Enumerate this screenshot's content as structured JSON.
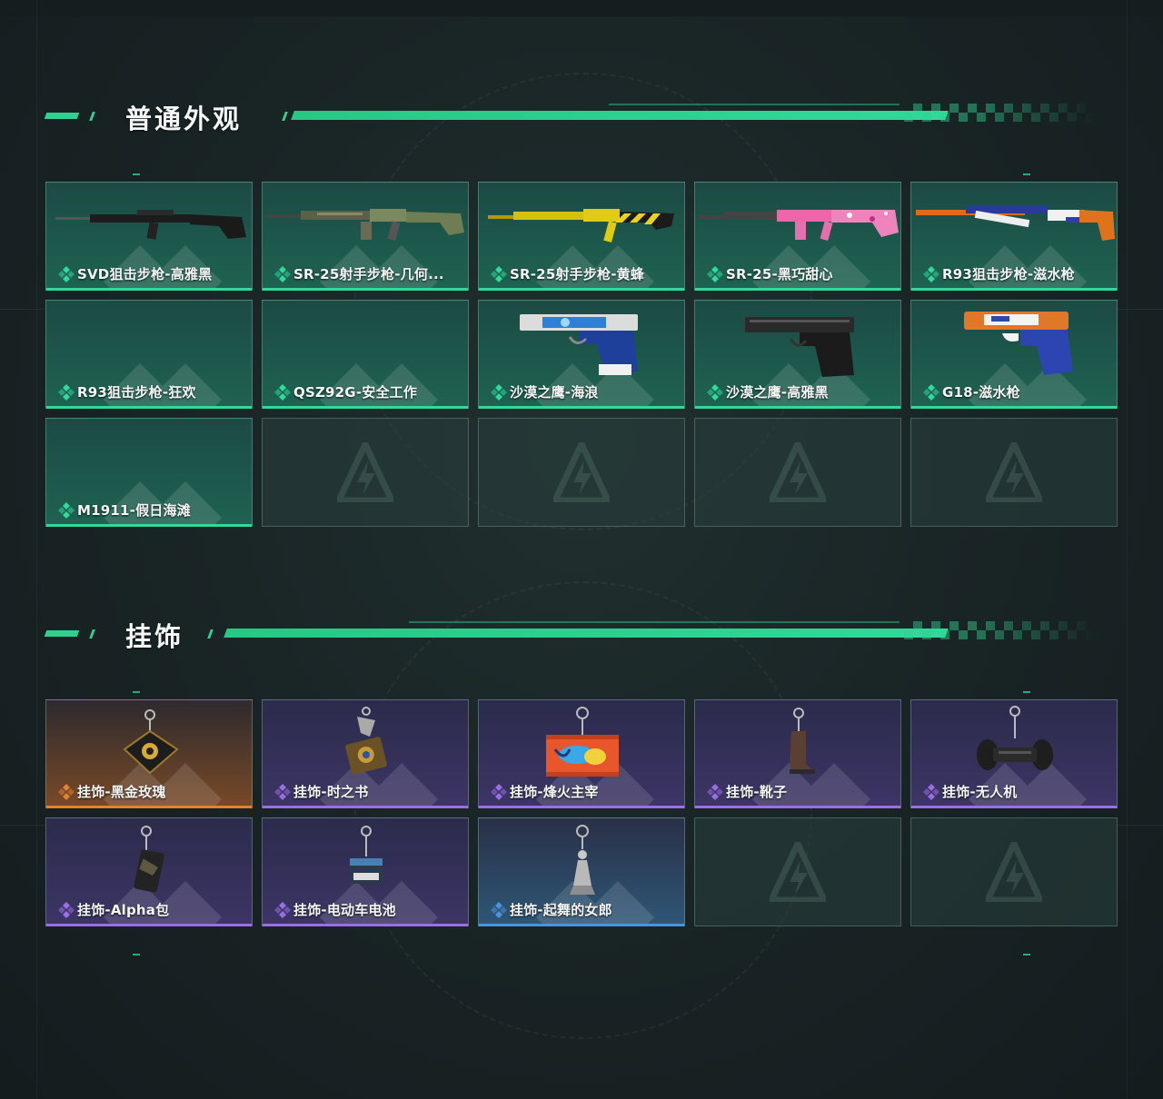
{
  "sections": [
    {
      "title": "普通外观",
      "items": [
        {
          "name": "SVD狙击步枪-高雅黑",
          "rarity": "green",
          "icon": "sniper-rifle-black-icon"
        },
        {
          "name": "SR-25射手步枪-几何...",
          "rarity": "green",
          "icon": "rifle-camo-icon"
        },
        {
          "name": "SR-25射手步枪-黄蜂",
          "rarity": "green",
          "icon": "rifle-yellow-icon"
        },
        {
          "name": "SR-25-黑巧甜心",
          "rarity": "green",
          "icon": "rifle-pink-icon"
        },
        {
          "name": "R93狙击步枪-滋水枪",
          "rarity": "green",
          "icon": "sniper-water-gun-icon"
        },
        {
          "name": "R93狙击步枪-狂欢",
          "rarity": "green",
          "icon": ""
        },
        {
          "name": "QSZ92G-安全工作",
          "rarity": "green",
          "icon": ""
        },
        {
          "name": "沙漠之鹰-海浪",
          "rarity": "green",
          "icon": "pistol-wave-icon"
        },
        {
          "name": "沙漠之鹰-高雅黑",
          "rarity": "green",
          "icon": "pistol-black-icon"
        },
        {
          "name": "G18-滋水枪",
          "rarity": "green",
          "icon": "pistol-water-gun-icon"
        },
        {
          "name": "M1911-假日海滩",
          "rarity": "green",
          "icon": ""
        }
      ],
      "empty_slots": 4
    },
    {
      "title": "挂饰",
      "items": [
        {
          "name": "挂饰-黑金玫瑰",
          "rarity": "orange",
          "icon": "charm-black-gold-rose-icon"
        },
        {
          "name": "挂饰-时之书",
          "rarity": "purple",
          "icon": "charm-book-icon"
        },
        {
          "name": "挂饰-烽火主宰",
          "rarity": "purple",
          "icon": "charm-container-icon"
        },
        {
          "name": "挂饰-靴子",
          "rarity": "purple",
          "icon": "charm-boot-icon"
        },
        {
          "name": "挂饰-无人机",
          "rarity": "purple",
          "icon": "charm-drone-icon"
        },
        {
          "name": "挂饰-Alpha包",
          "rarity": "purple",
          "icon": "charm-bag-icon"
        },
        {
          "name": "挂饰-电动车电池",
          "rarity": "purple",
          "icon": "charm-battery-icon"
        },
        {
          "name": "挂饰-起舞的女郎",
          "rarity": "blue",
          "icon": "charm-dancer-icon"
        }
      ],
      "empty_slots": 2
    }
  ],
  "colors": {
    "accent": "#31d99a",
    "green": "#31d99a",
    "purple": "#9b6ee6",
    "orange": "#e0822f",
    "blue": "#4a93dd"
  }
}
